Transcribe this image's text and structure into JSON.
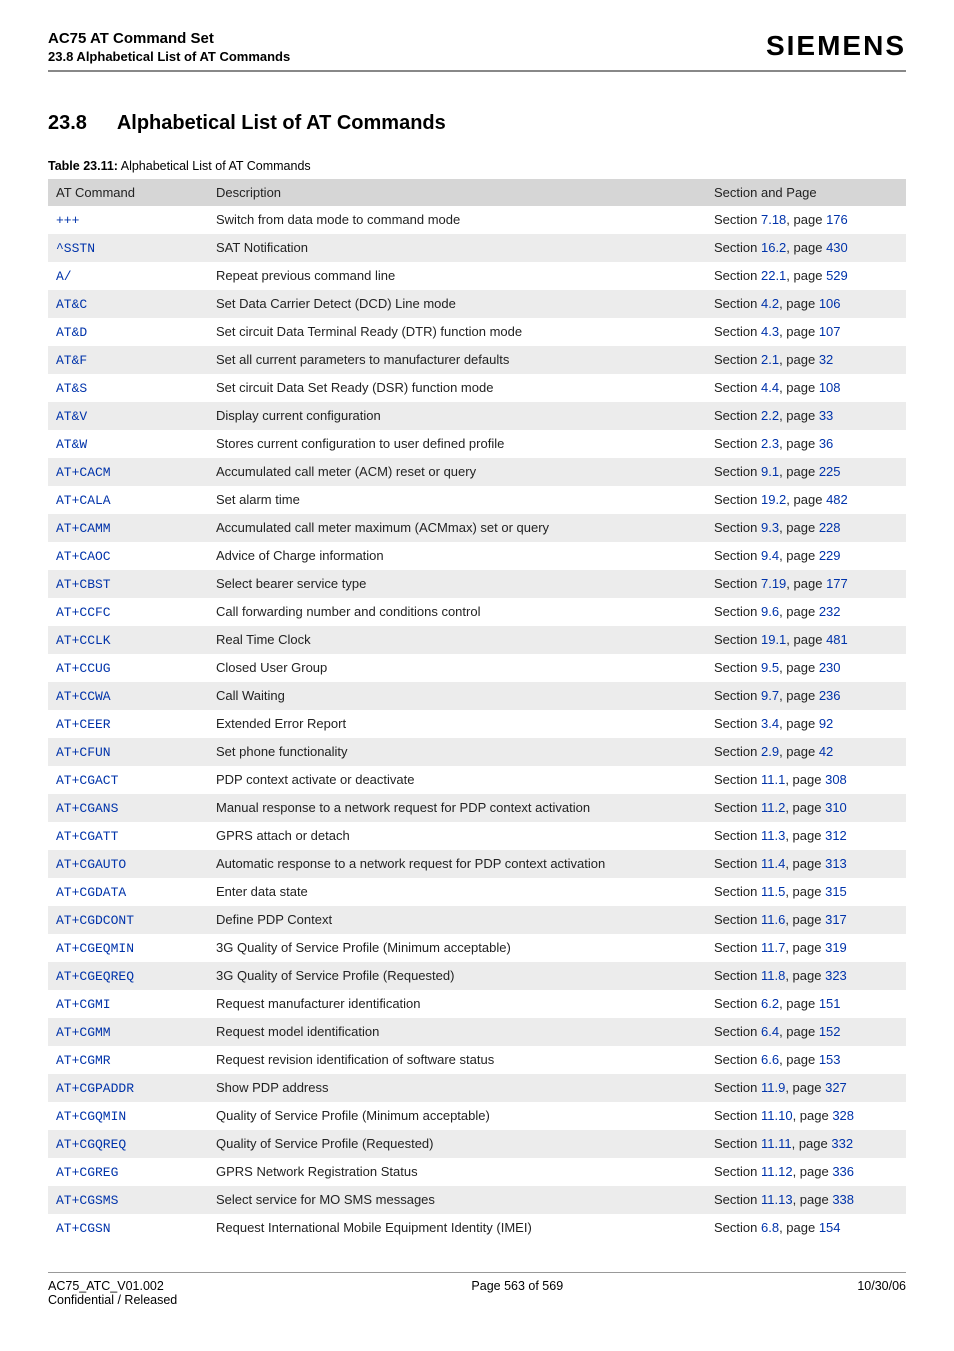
{
  "header": {
    "doc_title": "AC75 AT Command Set",
    "doc_sub": "23.8 Alphabetical List of AT Commands",
    "brand": "SIEMENS"
  },
  "section": {
    "number": "23.8",
    "title": "Alphabetical List of AT Commands"
  },
  "table": {
    "caption_bold": "Table 23.11:",
    "caption_rest": " Alphabetical List of AT Commands",
    "headers": {
      "cmd": "AT Command",
      "desc": "Description",
      "ref": "Section and Page"
    },
    "rows": [
      {
        "cmd": "+++",
        "desc": "Switch from data mode to command mode",
        "sec": "7.18",
        "page": "176"
      },
      {
        "cmd": "^SSTN",
        "desc": "SAT Notification",
        "sec": "16.2",
        "page": "430"
      },
      {
        "cmd": "A/",
        "desc": "Repeat previous command line",
        "sec": "22.1",
        "page": "529"
      },
      {
        "cmd": "AT&C",
        "desc": "Set Data Carrier Detect (DCD) Line mode",
        "sec": "4.2",
        "page": "106"
      },
      {
        "cmd": "AT&D",
        "desc": "Set circuit Data Terminal Ready (DTR) function mode",
        "sec": "4.3",
        "page": "107"
      },
      {
        "cmd": "AT&F",
        "desc": "Set all current parameters to manufacturer defaults",
        "sec": "2.1",
        "page": "32"
      },
      {
        "cmd": "AT&S",
        "desc": "Set circuit Data Set Ready (DSR) function mode",
        "sec": "4.4",
        "page": "108"
      },
      {
        "cmd": "AT&V",
        "desc": "Display current configuration",
        "sec": "2.2",
        "page": "33"
      },
      {
        "cmd": "AT&W",
        "desc": "Stores current configuration to user defined profile",
        "sec": "2.3",
        "page": "36"
      },
      {
        "cmd": "AT+CACM",
        "desc": "Accumulated call meter (ACM) reset or query",
        "sec": "9.1",
        "page": "225"
      },
      {
        "cmd": "AT+CALA",
        "desc": "Set alarm time",
        "sec": "19.2",
        "page": "482"
      },
      {
        "cmd": "AT+CAMM",
        "desc": "Accumulated call meter maximum (ACMmax) set or query",
        "sec": "9.3",
        "page": "228"
      },
      {
        "cmd": "AT+CAOC",
        "desc": "Advice of Charge information",
        "sec": "9.4",
        "page": "229"
      },
      {
        "cmd": "AT+CBST",
        "desc": "Select bearer service type",
        "sec": "7.19",
        "page": "177"
      },
      {
        "cmd": "AT+CCFC",
        "desc": "Call forwarding number and conditions control",
        "sec": "9.6",
        "page": "232"
      },
      {
        "cmd": "AT+CCLK",
        "desc": "Real Time Clock",
        "sec": "19.1",
        "page": "481"
      },
      {
        "cmd": "AT+CCUG",
        "desc": "Closed User Group",
        "sec": "9.5",
        "page": "230"
      },
      {
        "cmd": "AT+CCWA",
        "desc": "Call Waiting",
        "sec": "9.7",
        "page": "236"
      },
      {
        "cmd": "AT+CEER",
        "desc": "Extended Error Report",
        "sec": "3.4",
        "page": "92"
      },
      {
        "cmd": "AT+CFUN",
        "desc": "Set phone functionality",
        "sec": "2.9",
        "page": "42"
      },
      {
        "cmd": "AT+CGACT",
        "desc": "PDP context activate or deactivate",
        "sec": "11.1",
        "page": "308"
      },
      {
        "cmd": "AT+CGANS",
        "desc": "Manual response to a network request for PDP context activation",
        "sec": "11.2",
        "page": "310"
      },
      {
        "cmd": "AT+CGATT",
        "desc": "GPRS attach or detach",
        "sec": "11.3",
        "page": "312"
      },
      {
        "cmd": "AT+CGAUTO",
        "desc": "Automatic response to a network request for PDP context activation",
        "sec": "11.4",
        "page": "313"
      },
      {
        "cmd": "AT+CGDATA",
        "desc": "Enter data state",
        "sec": "11.5",
        "page": "315"
      },
      {
        "cmd": "AT+CGDCONT",
        "desc": "Define PDP Context",
        "sec": "11.6",
        "page": "317"
      },
      {
        "cmd": "AT+CGEQMIN",
        "desc": "3G Quality of Service Profile (Minimum acceptable)",
        "sec": "11.7",
        "page": "319"
      },
      {
        "cmd": "AT+CGEQREQ",
        "desc": "3G Quality of Service Profile (Requested)",
        "sec": "11.8",
        "page": "323"
      },
      {
        "cmd": "AT+CGMI",
        "desc": "Request manufacturer identification",
        "sec": "6.2",
        "page": "151"
      },
      {
        "cmd": "AT+CGMM",
        "desc": "Request model identification",
        "sec": "6.4",
        "page": "152"
      },
      {
        "cmd": "AT+CGMR",
        "desc": "Request revision identification of software status",
        "sec": "6.6",
        "page": "153"
      },
      {
        "cmd": "AT+CGPADDR",
        "desc": "Show PDP address",
        "sec": "11.9",
        "page": "327"
      },
      {
        "cmd": "AT+CGQMIN",
        "desc": "Quality of Service Profile (Minimum acceptable)",
        "sec": "11.10",
        "page": "328"
      },
      {
        "cmd": "AT+CGQREQ",
        "desc": "Quality of Service Profile (Requested)",
        "sec": "11.11",
        "page": "332"
      },
      {
        "cmd": "AT+CGREG",
        "desc": "GPRS Network Registration Status",
        "sec": "11.12",
        "page": "336"
      },
      {
        "cmd": "AT+CGSMS",
        "desc": "Select service for MO SMS messages",
        "sec": "11.13",
        "page": "338"
      },
      {
        "cmd": "AT+CGSN",
        "desc": "Request International Mobile Equipment Identity (IMEI)",
        "sec": "6.8",
        "page": "154"
      }
    ]
  },
  "footer": {
    "left_line1": "AC75_ATC_V01.002",
    "left_line2": "Confidential / Released",
    "center": "Page 563 of 569",
    "right": "10/30/06"
  }
}
